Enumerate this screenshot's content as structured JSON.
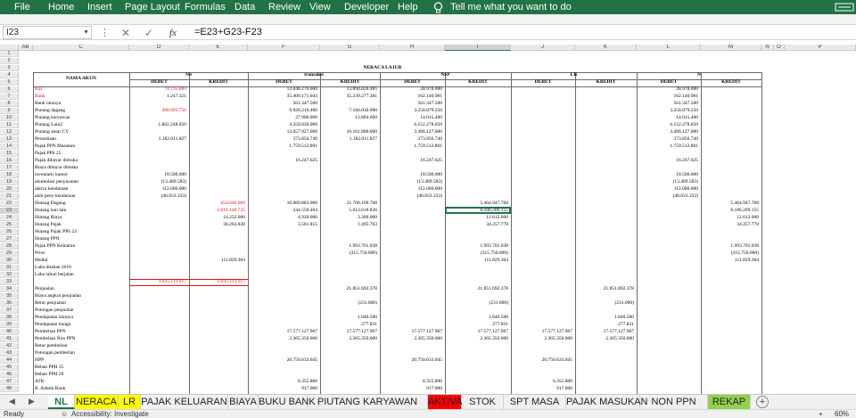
{
  "menu": {
    "items": [
      "File",
      "Home",
      "Insert",
      "Page Layout",
      "Formulas",
      "Data",
      "Review",
      "View",
      "Developer",
      "Help"
    ],
    "tell_me": "Tell me what you want to do"
  },
  "formula_bar": {
    "name_box": "I23",
    "fx_label": "fx",
    "formula": "=E23+G23-F23"
  },
  "columns": [
    "AB",
    "C",
    "D",
    "E",
    "F",
    "G",
    "H",
    "I",
    "J",
    "K",
    "L",
    "M",
    "N",
    "O",
    "P"
  ],
  "selected_column": "I",
  "rows": [
    "1",
    "2",
    "3",
    "4",
    "5",
    "6",
    "7",
    "8",
    "9",
    "10",
    "11",
    "12",
    "13",
    "14",
    "15",
    "16",
    "17",
    "18",
    "19",
    "20",
    "21",
    "22",
    "23",
    "24",
    "25",
    "26",
    "27",
    "28",
    "29",
    "30",
    "31",
    "32",
    "33",
    "34",
    "35",
    "36",
    "37",
    "38",
    "39",
    "40",
    "41",
    "42",
    "43",
    "44",
    "45",
    "46",
    "47",
    "48"
  ],
  "selected_row": "23",
  "sheet": {
    "title": "NERACA LAJUR",
    "header": {
      "nama_akun": "NAMA AKUN",
      "groups": [
        "NS",
        "transaksi",
        "NSP",
        "LR",
        "N"
      ],
      "debet": "DEBET",
      "kredit": "KREDIT"
    },
    "accounts": [
      "Kas",
      "Bank",
      "Bank lainnya",
      "Piutang dagang",
      "Piutang karyawan",
      "Piutang Lain2",
      "Piutang antar CV",
      "Persediaan",
      "Pajak PPN Masukan",
      "Pajak PPh 25",
      "Pajak dibayar dimuka",
      "Biaya dibayar dimuka",
      "inventaris kantor",
      "akumulasi penyusutan",
      "aktiva kendaraan",
      "akm peny kendaraan",
      "Hutang Dagang",
      "Hutang lain lain",
      "Hutang Biaya",
      "Hutang Pajak",
      "Hutang Pajak PPh 23",
      "Hutang PPN",
      "Pajak PPN Keluaran",
      "Prive",
      "Modal",
      "Laba ditahan 2018",
      "Laba tahun berjalan",
      "",
      "Penjualan",
      "Biaya angkut penjualan",
      "Retur penjualan",
      "Potongan penjualan",
      "Pendapatan lainnya",
      "Pendapatan bunga",
      "Pembelian PPN",
      "Pembelian Non PPN",
      "Retur pembelian",
      "Potongan pembelian",
      "HPP",
      "Beban PPH 25",
      "Beban PPH 29",
      "ATK",
      "B. Admin Bank"
    ],
    "ns_debet": [
      "74.735.883",
      "1.247.321",
      "",
      "498.893.750",
      "",
      "1.802.248.050",
      "",
      "1.182.011.827",
      "",
      "",
      "",
      "",
      "18.500.000",
      "(13.489.583)",
      "112.000.000",
      "(40.833.333)",
      "",
      "",
      "",
      "",
      "",
      "",
      "",
      "",
      "",
      "",
      "",
      "3.635.113.917"
    ],
    "ns_kredit": [
      "",
      "",
      "",
      "",
      "",
      "",
      "",
      "",
      "",
      "",
      "",
      "",
      "",
      "",
      "",
      "",
      "654.640.000",
      "2.818.148.725",
      "14.232.000",
      "36.263.830",
      "",
      "",
      "",
      "",
      "111.829.364",
      "",
      "",
      "3.635.113.917"
    ],
    "tr_debet": [
      "13.848.270.600",
      "35.400.171.043",
      "561.347.500",
      "9.926.216.400",
      "27.900.000",
      "4.350.030.000",
      "13.657.927.000",
      "373.856.749",
      "1.759.512.801",
      "",
      "16.247.625",
      "",
      "",
      "",
      "",
      "",
      "16.889.883.000",
      "244.558.404",
      "4.920.000",
      "3.501.815",
      "",
      "",
      "",
      "",
      "",
      "",
      "",
      "",
      "",
      "",
      "",
      "",
      "",
      "",
      "17.577.127.967",
      "2.365.350.000",
      "",
      "",
      "20.750.633.045",
      "",
      "",
      "6.355.800",
      "917.000"
    ],
    "tr_kredit": [
      "13.894.028.485",
      "35.239.277.381",
      "",
      "7.166.030.900",
      "13.884.600",
      "",
      "10.161.800.000",
      "1.182.011.827",
      "",
      "",
      "",
      "",
      "",
      "",
      "",
      "",
      "21.700.190.768",
      "5.612.618.836",
      "3.300.000",
      "1.495.763",
      "",
      "",
      "1.993.701.038",
      "(315.750.000)",
      "",
      "",
      "",
      "",
      "21.851.692.378",
      "",
      "(231.000)",
      "",
      "1.840.500",
      "277.831",
      "17.577.127.967",
      "2.365.350.000"
    ],
    "nsp_debet": [
      "28.978.000",
      "162.140.981",
      "561.347.500",
      "3.258.879.250",
      "14.015.400",
      "6.152.278.050",
      "3.496.127.000",
      "373.856.749",
      "1.759.512.801",
      "",
      "16.247.625",
      "",
      "18.500.000",
      "(13.489.583)",
      "112.000.000",
      "(40.833.333)",
      "",
      "",
      "",
      "",
      "",
      "",
      "",
      "",
      "",
      "",
      "",
      "",
      "",
      "",
      "",
      "",
      "",
      "",
      "17.577.127.967",
      "2.365.350.000",
      "",
      "",
      "20.750.633.045",
      "",
      "",
      "6.355.800",
      "917.000"
    ],
    "nsp_kredit": [
      "",
      "",
      "",
      "",
      "",
      "",
      "",
      "",
      "",
      "",
      "",
      "",
      "",
      "",
      "",
      "",
      "5.464.947.768",
      "8.186.209.155",
      "12.612.000",
      "34.257.778",
      "",
      "",
      "1.993.701.038",
      "(315.750.000)",
      "111.829.364",
      "",
      "",
      "",
      "21.851.692.378",
      "",
      "(231.000)",
      "",
      "1.840.500",
      "277.831",
      "17.577.127.967",
      "2.365.350.000"
    ],
    "lr_debet": [
      "",
      "",
      "",
      "",
      "",
      "",
      "",
      "",
      "",
      "",
      "",
      "",
      "",
      "",
      "",
      "",
      "",
      "",
      "",
      "",
      "",
      "",
      "",
      "",
      "",
      "",
      "",
      "",
      "",
      "",
      "",
      "",
      "",
      "",
      "17.577.127.967",
      "2.365.350.000",
      "",
      "",
      "20.750.633.045",
      "",
      "",
      "6.355.800",
      "917.000"
    ],
    "lr_kredit": [
      "",
      "",
      "",
      "",
      "",
      "",
      "",
      "",
      "",
      "",
      "",
      "",
      "",
      "",
      "",
      "",
      "",
      "",
      "",
      "",
      "",
      "",
      "",
      "",
      "",
      "",
      "",
      "",
      "21.851.692.378",
      "",
      "(231.000)",
      "",
      "1.840.500",
      "277.831",
      "17.577.127.967",
      "2.365.350.000"
    ],
    "n_debet": [
      "28.978.000",
      "162.140.981",
      "561.347.500",
      "3.258.879.250",
      "14.015.400",
      "6.152.278.050",
      "3.496.127.000",
      "373.856.749",
      "1.759.512.801",
      "",
      "16.247.625",
      "",
      "18.500.000",
      "(13.489.583)",
      "112.000.000",
      "(40.833.333)"
    ],
    "n_kredit": [
      "",
      "",
      "",
      "",
      "",
      "",
      "",
      "",
      "",
      "",
      "",
      "",
      "",
      "",
      "",
      "",
      "5.464.947.768",
      "8.186.209.155",
      "12.612.000",
      "34.257.778",
      "",
      "",
      "1.993.701.038",
      "(315.750.000)",
      "111.829.364"
    ]
  },
  "tabs": [
    "NL",
    "NERACA",
    "LR",
    "PAJAK KELUARAN",
    "BIAYA",
    "BUKU BANK",
    "PIUTANG KARYAWAN",
    "AKTIVA",
    "STOK",
    "SPT MASA",
    "PAJAK MASUKAN",
    "NON PPN",
    "REKAP"
  ],
  "active_tab": "NL",
  "tab_colors": {
    "NERACA": "#ffff00",
    "LR": "#ffff00",
    "AKTIVA": "#ff0000",
    "REKAP": "#92d050"
  },
  "tab_nav": {
    "prev": "◀",
    "next": "▶",
    "add": "+"
  },
  "status": {
    "ready": "Ready",
    "accessibility": "Accessibility: Investigate",
    "zoom": "60%"
  },
  "colors": {
    "excel_green": "#217346",
    "negative_red": "#e8101e"
  }
}
